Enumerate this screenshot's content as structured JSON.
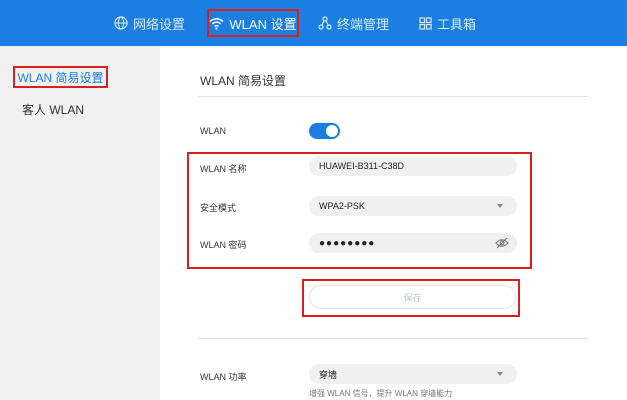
{
  "nav": {
    "network": "网络设置",
    "wlan": "WLAN 设置",
    "terminal": "终端管理",
    "toolbox": "工具箱"
  },
  "sidebar": {
    "items": [
      {
        "label": "WLAN 简易设置",
        "active": true
      },
      {
        "label": "客人 WLAN",
        "active": false
      }
    ]
  },
  "main": {
    "title": "WLAN 简易设置",
    "wlan_label": "WLAN",
    "wlan_enabled": true,
    "ssid_label": "WLAN 名称",
    "ssid_value": "HUAWEI-B311-C38D",
    "mode_label": "安全模式",
    "mode_value": "WPA2-PSK",
    "password_label": "WLAN 密码",
    "password_value": "●●●●●●●●",
    "save_label": "保存",
    "power_label": "WLAN 功率",
    "power_value": "穿墙",
    "power_hint": "增强 WLAN 信号，提升 WLAN 穿墙能力"
  },
  "colors": {
    "accent": "#1a7fe0",
    "highlight": "#d92020",
    "sidebar_bg": "#f1f1f1"
  }
}
